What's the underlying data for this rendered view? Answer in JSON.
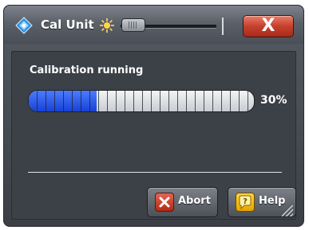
{
  "window": {
    "title": "Cal Unit",
    "close_label": "X"
  },
  "icons": {
    "app": "diamond-app-icon",
    "brightness": "sun-icon",
    "abort": "x-icon",
    "help": "question-chat-icon"
  },
  "brightness_slider": {
    "value_fraction": 0.05
  },
  "calibration": {
    "status": "Calibration running",
    "progress_percent": 30,
    "progress_text": "30%"
  },
  "buttons": {
    "abort_label": "Abort",
    "help_label": "Help"
  },
  "colors": {
    "progress_fill": "#1f4fe3",
    "close_button": "#c6412d"
  }
}
